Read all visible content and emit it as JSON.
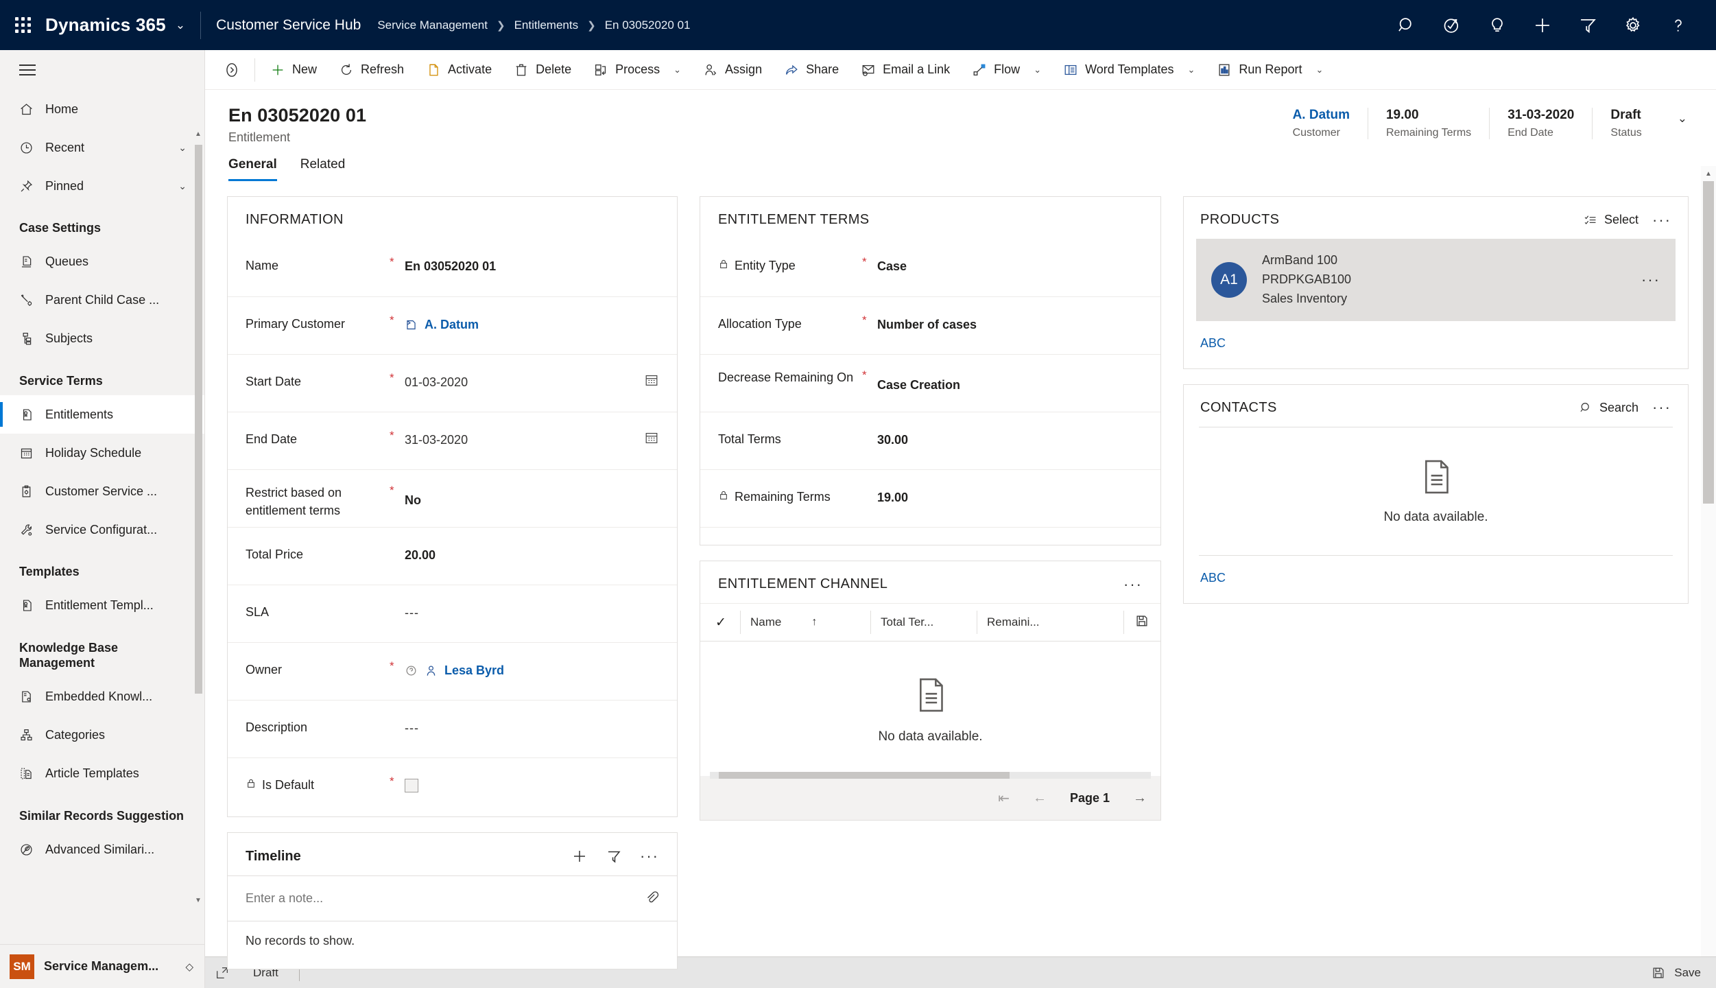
{
  "topnav": {
    "waffle": "app-launcher",
    "brand": "Dynamics 365",
    "app_name": "Customer Service Hub",
    "breadcrumb": [
      "Service Management",
      "Entitlements",
      "En 03052020 01"
    ],
    "icons": [
      "search-icon",
      "relationship-assistant-icon",
      "lightbulb-icon",
      "plus-icon",
      "filter-icon",
      "gear-icon",
      "help-icon"
    ]
  },
  "sidebar": {
    "top_items": [
      {
        "label": "Home",
        "icon": "home-icon",
        "chevron": ""
      },
      {
        "label": "Recent",
        "icon": "clock-icon",
        "chevron": "⌄"
      },
      {
        "label": "Pinned",
        "icon": "pin-icon",
        "chevron": "⌄"
      }
    ],
    "groups": [
      {
        "title": "Case Settings",
        "items": [
          {
            "label": "Queues",
            "icon": "queue-icon"
          },
          {
            "label": "Parent Child Case ...",
            "icon": "parent-child-case-icon"
          },
          {
            "label": "Subjects",
            "icon": "subjects-icon"
          }
        ]
      },
      {
        "title": "Service Terms",
        "items": [
          {
            "label": "Entitlements",
            "icon": "entitlement-icon",
            "selected": true
          },
          {
            "label": "Holiday Schedule",
            "icon": "calendar-icon"
          },
          {
            "label": "Customer Service ...",
            "icon": "clipboard-gear-icon"
          },
          {
            "label": "Service Configurat...",
            "icon": "wrench-gear-icon"
          }
        ]
      },
      {
        "title": "Templates",
        "items": [
          {
            "label": "Entitlement Templ...",
            "icon": "entitlement-template-icon"
          }
        ]
      },
      {
        "title": "Knowledge Base Management",
        "items": [
          {
            "label": "Embedded Knowl...",
            "icon": "embedded-knowledge-icon"
          },
          {
            "label": "Categories",
            "icon": "categories-icon"
          },
          {
            "label": "Article Templates",
            "icon": "article-template-icon"
          }
        ]
      },
      {
        "title": "Similar Records Suggestion",
        "items": [
          {
            "label": "Advanced Similari...",
            "icon": "advanced-similarity-icon"
          }
        ]
      }
    ],
    "footer": {
      "badge": "SM",
      "label": "Service Managem..."
    }
  },
  "commandbar": {
    "buttons": [
      {
        "label": "New",
        "icon": "plus-icon",
        "caret": false
      },
      {
        "label": "Refresh",
        "icon": "refresh-icon",
        "caret": false
      },
      {
        "label": "Activate",
        "icon": "activate-icon",
        "caret": false
      },
      {
        "label": "Delete",
        "icon": "trash-icon",
        "caret": false
      },
      {
        "label": "Process",
        "icon": "process-icon",
        "caret": true
      },
      {
        "label": "Assign",
        "icon": "assign-user-icon",
        "caret": false
      },
      {
        "label": "Share",
        "icon": "share-icon",
        "caret": false
      },
      {
        "label": "Email a Link",
        "icon": "email-link-icon",
        "caret": false
      },
      {
        "label": "Flow",
        "icon": "flow-icon",
        "caret": true
      },
      {
        "label": "Word Templates",
        "icon": "word-template-icon",
        "caret": true
      },
      {
        "label": "Run Report",
        "icon": "report-icon",
        "caret": true
      }
    ]
  },
  "record": {
    "title": "En 03052020 01",
    "subtitle": "Entitlement",
    "header_fields": [
      {
        "value": "A. Datum",
        "label": "Customer",
        "is_link": true
      },
      {
        "value": "19.00",
        "label": "Remaining Terms",
        "is_link": false
      },
      {
        "value": "31-03-2020",
        "label": "End Date",
        "is_link": false
      },
      {
        "value": "Draft",
        "label": "Status",
        "is_link": false
      }
    ],
    "tabs": [
      {
        "label": "General",
        "active": true
      },
      {
        "label": "Related",
        "active": false
      }
    ]
  },
  "information": {
    "title": "INFORMATION",
    "rows": [
      {
        "label": "Name",
        "required": true,
        "value": "En 03052020 01",
        "type": "text",
        "locked": false
      },
      {
        "label": "Primary Customer",
        "required": true,
        "value": "A. Datum",
        "type": "lookup-account",
        "locked": false
      },
      {
        "label": "Start Date",
        "required": true,
        "value": "01-03-2020",
        "type": "date",
        "locked": false
      },
      {
        "label": "End Date",
        "required": true,
        "value": "31-03-2020",
        "type": "date",
        "locked": false
      },
      {
        "label": "Restrict based on entitlement terms",
        "required": true,
        "value": "No",
        "type": "text",
        "locked": false
      },
      {
        "label": "Total Price",
        "required": false,
        "value": "20.00",
        "type": "text",
        "locked": false
      },
      {
        "label": "SLA",
        "required": false,
        "value": "---",
        "type": "empty",
        "locked": false
      },
      {
        "label": "Owner",
        "required": true,
        "value": "Lesa Byrd",
        "type": "lookup-user",
        "locked": false
      },
      {
        "label": "Description",
        "required": false,
        "value": "---",
        "type": "empty",
        "locked": false
      },
      {
        "label": "Is Default",
        "required": true,
        "value": "",
        "type": "checkbox",
        "locked": true
      }
    ]
  },
  "entitlement_terms": {
    "title": "ENTITLEMENT TERMS",
    "rows": [
      {
        "label": "Entity Type",
        "required": true,
        "value": "Case",
        "locked": true
      },
      {
        "label": "Allocation Type",
        "required": true,
        "value": "Number of cases",
        "locked": false
      },
      {
        "label": "Decrease Remaining On",
        "required": true,
        "value": "Case Creation",
        "locked": false
      },
      {
        "label": "Total Terms",
        "required": false,
        "value": "30.00",
        "locked": false
      },
      {
        "label": "Remaining Terms",
        "required": false,
        "value": "19.00",
        "locked": true
      }
    ]
  },
  "entitlement_channel": {
    "title": "ENTITLEMENT CHANNEL",
    "more_label": "···",
    "columns": [
      "Name",
      "Total Ter...",
      "Remaini..."
    ],
    "sort_indicator": "↑",
    "empty_message": "No data available.",
    "page_label": "Page 1"
  },
  "timeline": {
    "title": "Timeline",
    "note_placeholder": "Enter a note...",
    "empty_message": "No records to show."
  },
  "products": {
    "title": "PRODUCTS",
    "action_label": "Select",
    "items": [
      {
        "initials": "A1",
        "name": "ArmBand 100",
        "code": "PRDPKGAB100",
        "category": "Sales Inventory"
      }
    ],
    "footer_link": "ABC"
  },
  "contacts": {
    "title": "CONTACTS",
    "action_label": "Search",
    "empty_message": "No data available.",
    "footer_link": "ABC"
  },
  "statusbar": {
    "status": "Draft",
    "save_label": "Save"
  },
  "colors": {
    "nav_bg": "#001b3d",
    "accent": "#0078d4",
    "link": "#0b5cab",
    "required": "#d13438",
    "avatar": "#2b579a",
    "app_badge": "#ca5010"
  }
}
